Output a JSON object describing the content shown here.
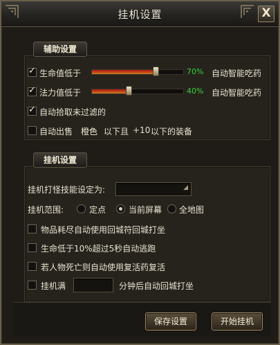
{
  "window": {
    "title": "挂机设置",
    "close_label": "X"
  },
  "section_assist": {
    "title": "辅助设置",
    "hp": {
      "label": "生命值低于",
      "checked": true,
      "level": 0.7,
      "pct_text": "70%",
      "action": "自动智能吃药"
    },
    "mp": {
      "label": "法力值低于",
      "checked": true,
      "level": 0.4,
      "pct_text": "40%",
      "action": "自动智能吃药"
    },
    "pickup": {
      "label": "自动拾取未过滤的",
      "checked": true
    },
    "autosell": {
      "label": "自动出售",
      "checked": false,
      "color": "橙色",
      "below": "以下且",
      "level": "+10",
      "tail": "以下的装备"
    }
  },
  "section_hang": {
    "title": "挂机设置",
    "skill": {
      "label": "挂机打怪技能设定为:",
      "value": ""
    },
    "range": {
      "label": "挂机范围:",
      "options": [
        "定点",
        "当前屏幕",
        "全地图"
      ],
      "selected": 1
    },
    "opt_items": {
      "label": "物品耗尽自动使用回城符回城打坐",
      "checked": false
    },
    "opt_escape": {
      "label": "生命低于10%超过5秒自动逃跑",
      "checked": false
    },
    "opt_revive": {
      "label": "若人物死亡则自动使用复活药复活",
      "checked": false
    },
    "opt_timer": {
      "label": "挂机满",
      "value": "",
      "suffix": "分钟后自动回城打坐",
      "checked": false
    }
  },
  "footer": {
    "save_label": "保存设置",
    "start_label": "开始挂机"
  }
}
